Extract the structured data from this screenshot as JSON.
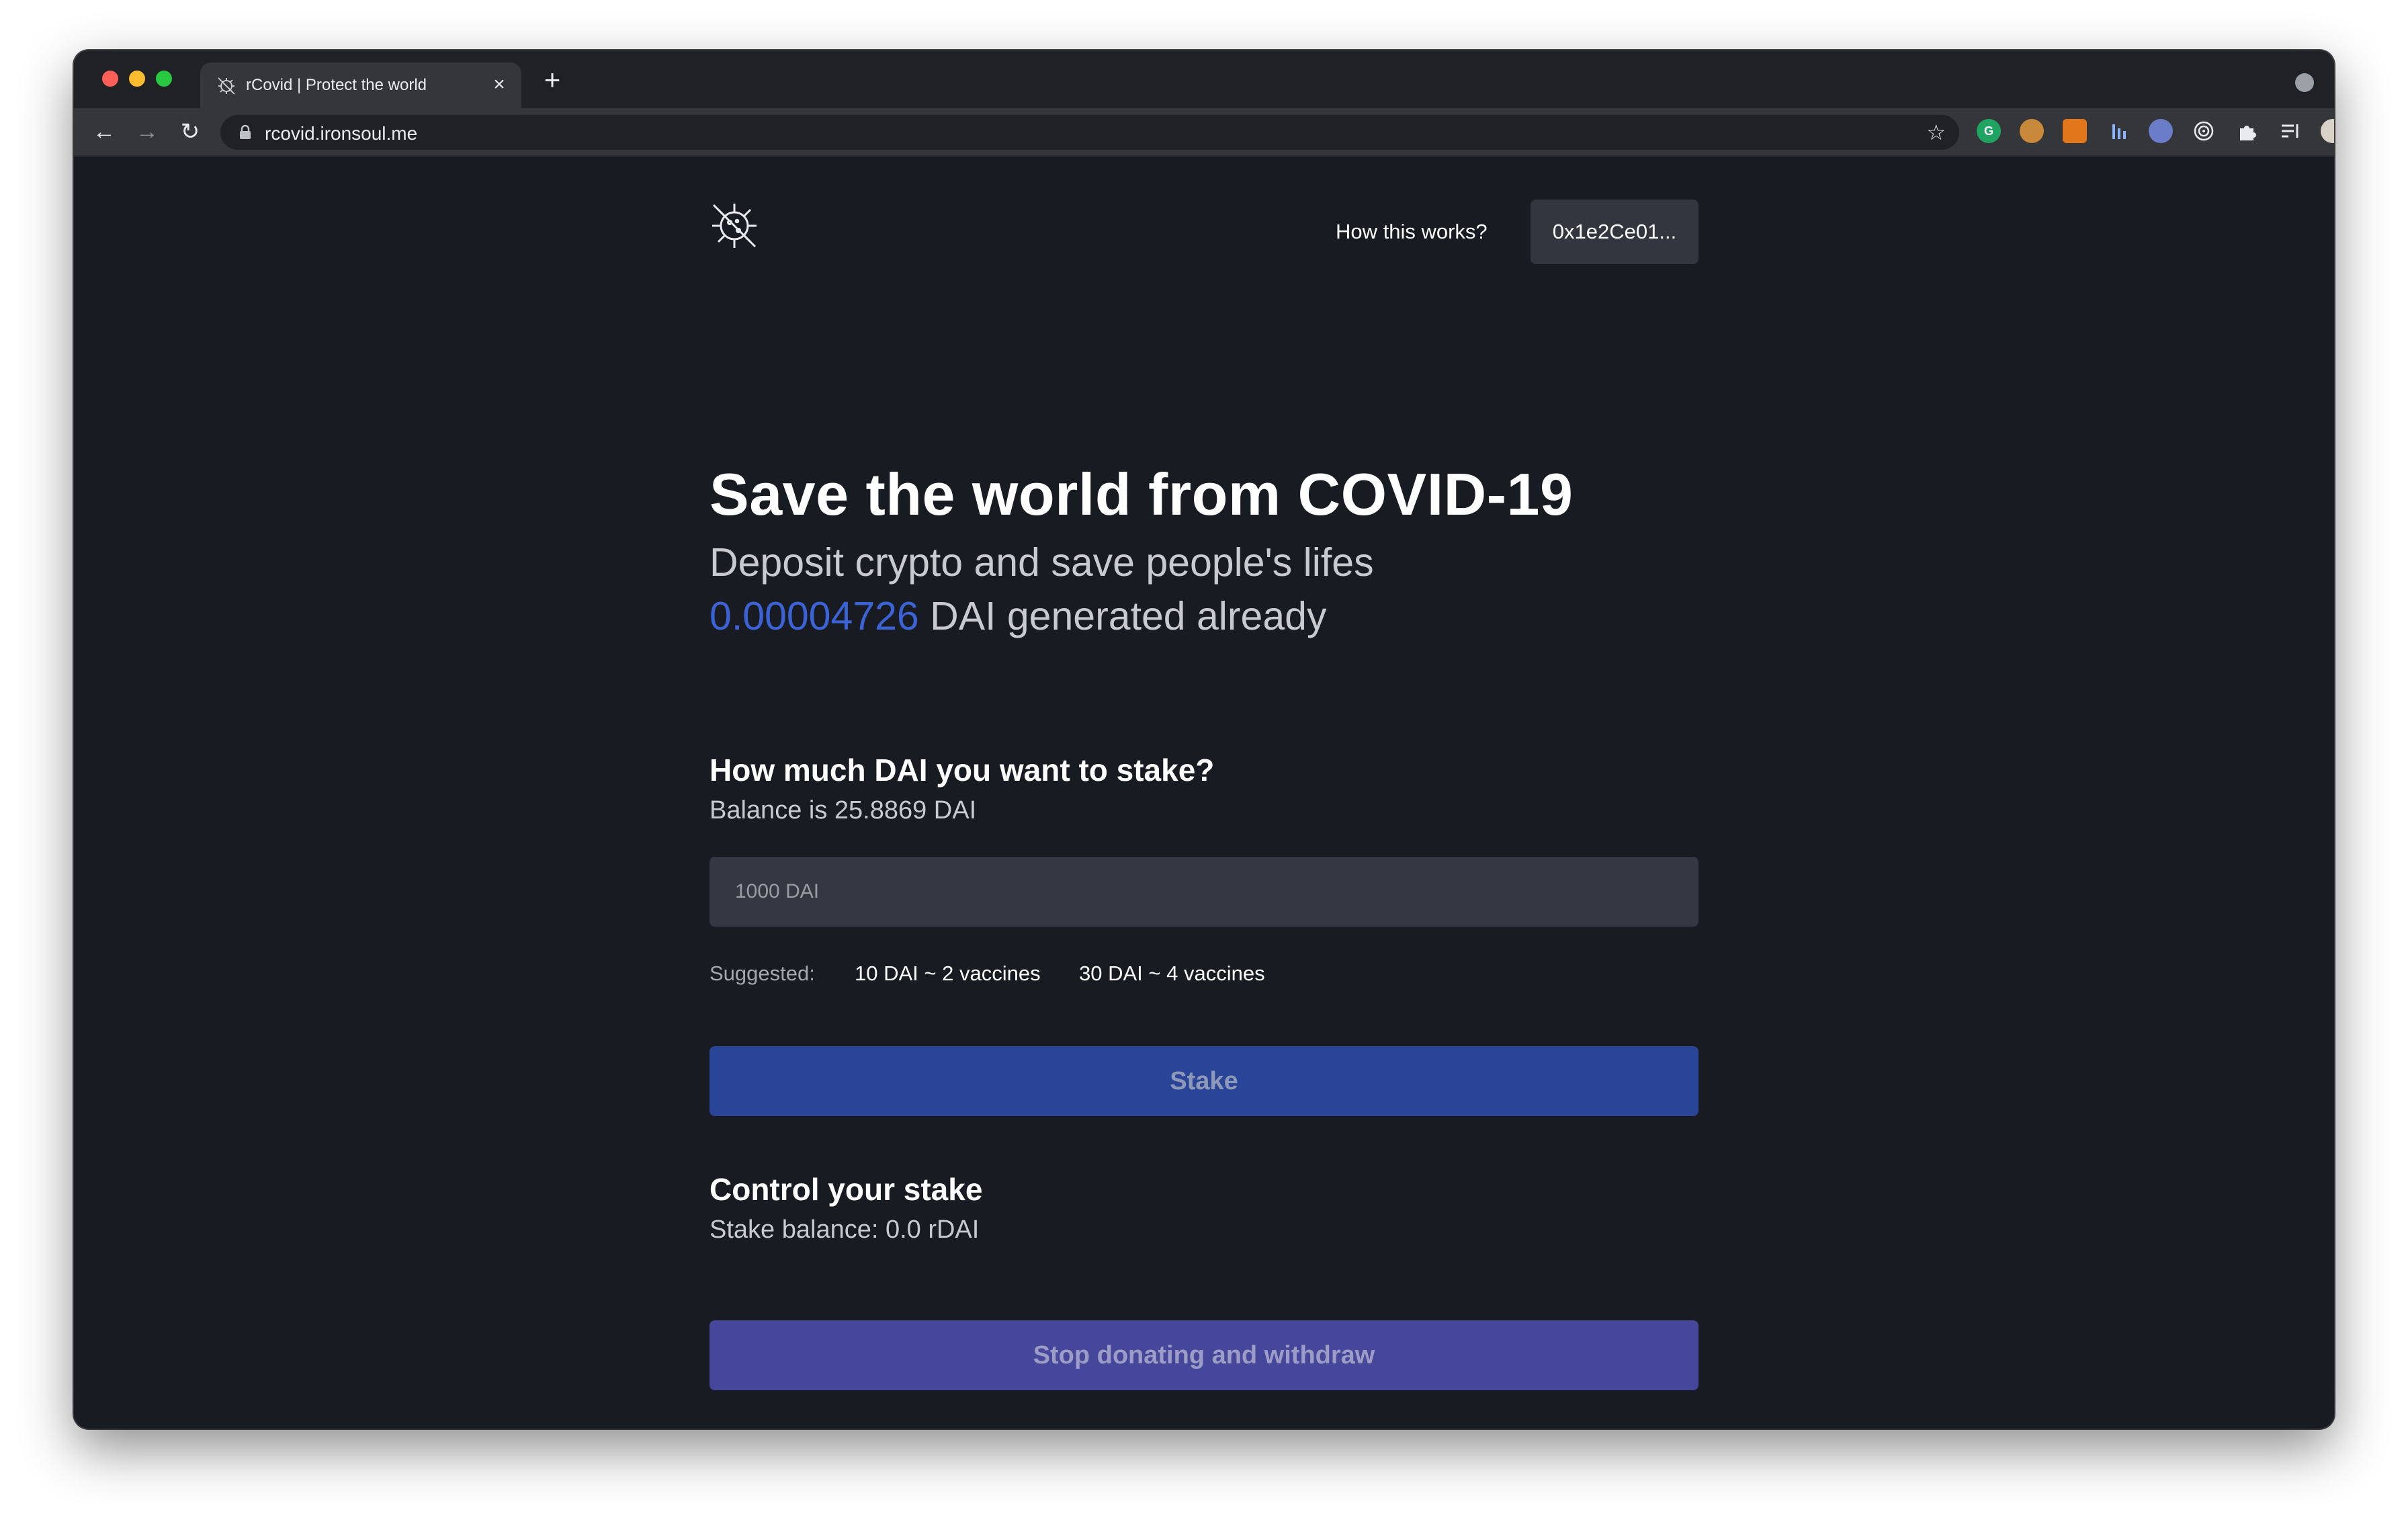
{
  "browser": {
    "tab_title": "rCovid | Protect the world",
    "url": "rcovid.ironsoul.me"
  },
  "header": {
    "how_link": "How this works?",
    "wallet_address": "0x1e2Ce01..."
  },
  "hero": {
    "title": "Save the world from COVID-19",
    "subtitle": "Deposit crypto and save people's lifes",
    "generated_amount": "0.00004726",
    "generated_suffix": " DAI generated already",
    "accent_color": "#3b63d6"
  },
  "stake": {
    "title": "How much DAI you want to stake?",
    "balance": "Balance is 25.8869 DAI",
    "input_placeholder": "1000 DAI",
    "input_value": "",
    "suggested_label": "Suggested:",
    "suggestions": [
      "10 DAI ~ 2 vaccines",
      "30 DAI ~ 4 vaccines"
    ],
    "button_label": "Stake"
  },
  "control": {
    "title": "Control your stake",
    "stake_balance": "Stake balance: 0.0 rDAI",
    "button_label": "Stop donating and withdraw"
  },
  "icons": {
    "tab_favicon": "virus-crossed-icon",
    "logo": "virus-crossed-icon",
    "lock": "lock-icon",
    "star": "star-icon",
    "extensions": [
      "grammarly-icon",
      "cookie-icon",
      "metamask-icon",
      "bars-icon",
      "ext-icon",
      "target-icon",
      "puzzle-icon",
      "reading-list-icon",
      "profile-avatar"
    ]
  }
}
